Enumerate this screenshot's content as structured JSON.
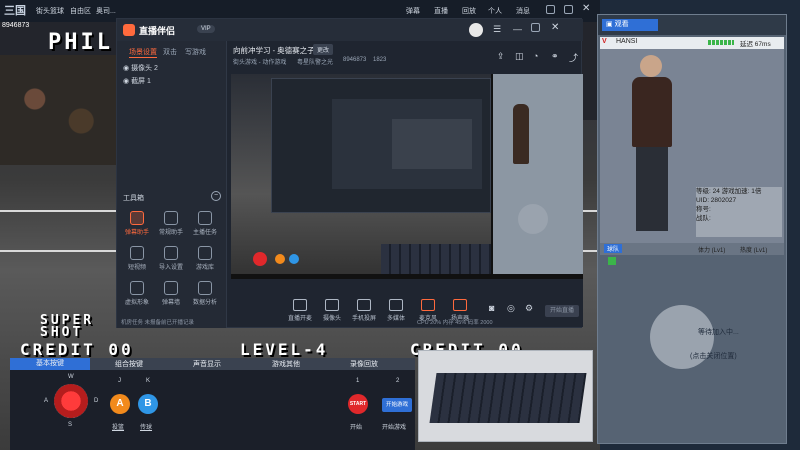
{
  "outer": {
    "logo": "三国",
    "stream_id": "8946873",
    "tabs": [
      "街头篮球",
      "自由区",
      "奥司..."
    ],
    "top_actions": [
      "弹幕",
      "直播",
      "回放",
      "个人",
      "消息"
    ]
  },
  "window": {
    "brand": "直播伴侣",
    "brand_badge": "VIP",
    "sidebar_tabs": [
      "场景设置",
      "双击",
      "写游戏"
    ],
    "scenes": [
      "摄像头 2",
      "截屏 1"
    ],
    "toolbox_label": "工具箱",
    "tools": [
      {
        "label": "弹幕助手",
        "icon": "danmaku-icon",
        "hot": true
      },
      {
        "label": "常规助手",
        "icon": "assistant-icon",
        "hot": false
      },
      {
        "label": "主播任务",
        "icon": "task-icon",
        "hot": false
      },
      {
        "label": "短视频",
        "icon": "video-icon",
        "hot": false
      },
      {
        "label": "导入设置",
        "icon": "import-icon",
        "hot": false
      },
      {
        "label": "游戏库",
        "icon": "game-icon",
        "hot": false
      },
      {
        "label": "虚拟形象",
        "icon": "avatar-icon",
        "hot": false
      },
      {
        "label": "弹幕墙",
        "icon": "wall-icon",
        "hot": false
      },
      {
        "label": "数据分析",
        "icon": "chart-icon",
        "hot": false
      }
    ],
    "room_title": "向前冲学习 - 奥德赛之子!",
    "room_badge": "更改",
    "room_meta": [
      "街头游戏 - 动作游戏",
      "粤星队警之光",
      "8946873",
      "1823"
    ],
    "bottom_controls": [
      "直播开麦",
      "摄像头",
      "手机投屏",
      "多媒体",
      "麦克风",
      "扬声器"
    ],
    "start_live": "开始直播",
    "status_left": "机房任务 未报备前已开播记录",
    "status_right": "CPU 20%  内存 45%  码率 2000"
  },
  "game": {
    "credit_left": "CREDIT  00",
    "level": "LEVEL-4",
    "credit_right": "CREDIT  00",
    "super_shot": "SUPER\nSHOT",
    "phil": "PHIL"
  },
  "strip": {
    "headers": [
      "基本按键",
      "组合按键",
      "声音显示",
      "游戏其他",
      "录像回放"
    ],
    "dpad": {
      "up": "W",
      "left": "A",
      "right": "D",
      "down": "S"
    },
    "keys": [
      {
        "top": "J",
        "letter": "A",
        "caption": "投篮"
      },
      {
        "top": "K",
        "letter": "B",
        "caption": "传球"
      }
    ],
    "start_num": "1",
    "start_label": "START",
    "start_caption": "开始",
    "btn2_num": "2",
    "btn2_label": "开始游戏",
    "btn2_caption": "开始游戏"
  },
  "right_panel": {
    "title": "观看",
    "player_label": "HANSI",
    "latency": "延迟 67ms",
    "info_lines": [
      "等级: 24   游戏加速: 1倍",
      "UID: 2802027",
      "称号:",
      "战队:"
    ],
    "badge": "Lv1",
    "stats": [
      "体力 (Lv1)",
      "热度 (Lv1)"
    ],
    "waiting": "等待加入中...",
    "invite": "(点击关闭位置)",
    "tag": "球队"
  },
  "colors": {
    "accent": "#ff6a3d",
    "button_red": "#e0282b",
    "button_orange": "#f28a1c",
    "button_blue": "#2f96e6"
  }
}
